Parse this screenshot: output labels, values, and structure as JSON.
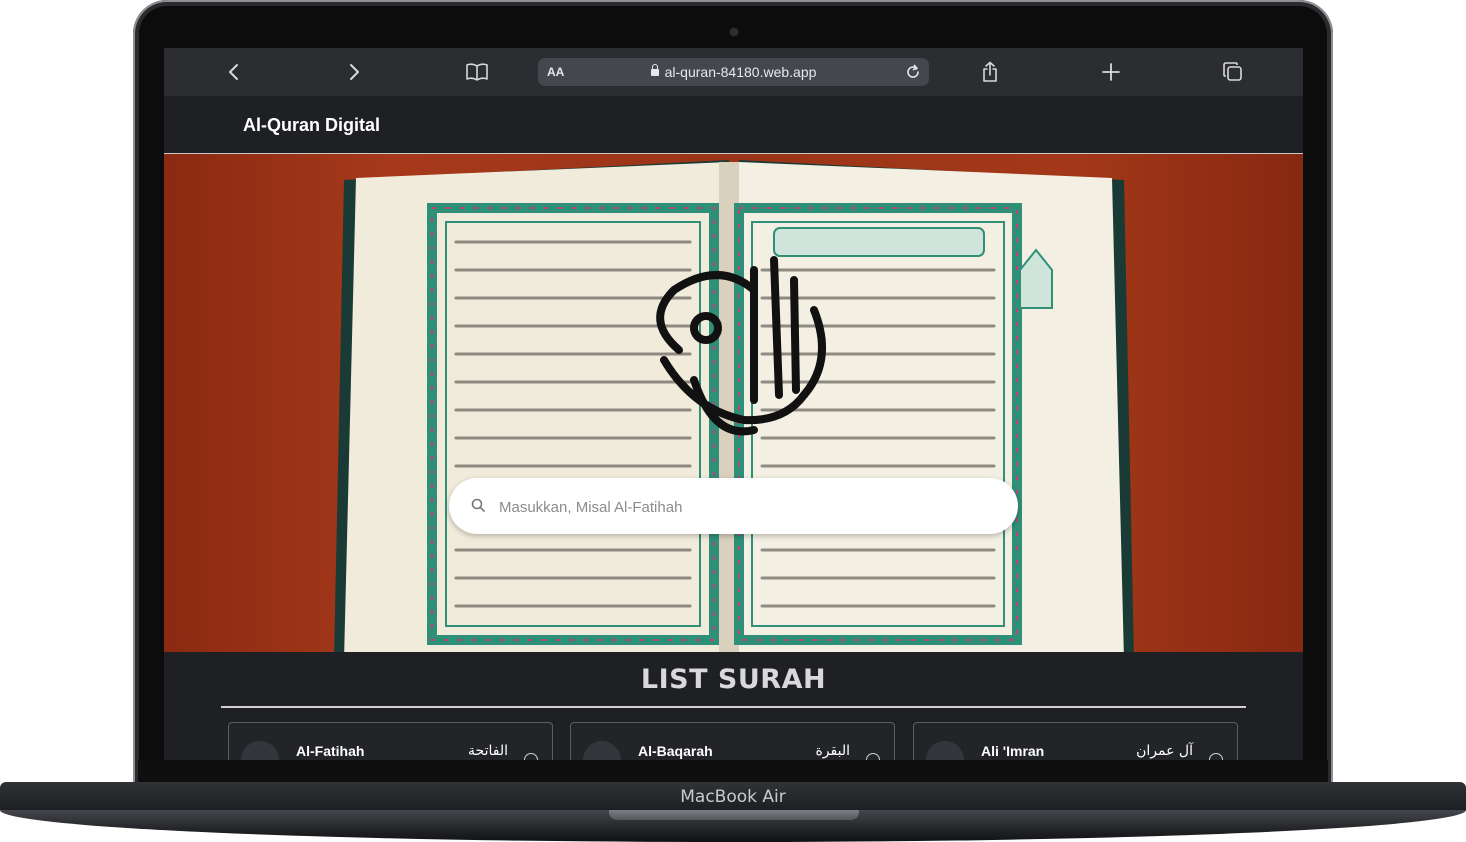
{
  "device": {
    "model_label": "MacBook Air"
  },
  "browser": {
    "text_size_label": "AA",
    "url": "al-quran-84180.web.app"
  },
  "site": {
    "brand": "Al-Quran Digital",
    "search": {
      "placeholder": "Masukkan, Misal Al-Fatihah",
      "value": ""
    },
    "list_title": "LIST SURAH",
    "surahs": [
      {
        "name": "Al-Fatihah",
        "arabic": "الفاتحة"
      },
      {
        "name": "Al-Baqarah",
        "arabic": "البقرة"
      },
      {
        "name": "Ali 'Imran",
        "arabic": "آل عمران"
      }
    ]
  },
  "colors": {
    "page_bg": "#1e2023",
    "accent_red": "#9b3418",
    "border_teal": "#2f8f77"
  }
}
